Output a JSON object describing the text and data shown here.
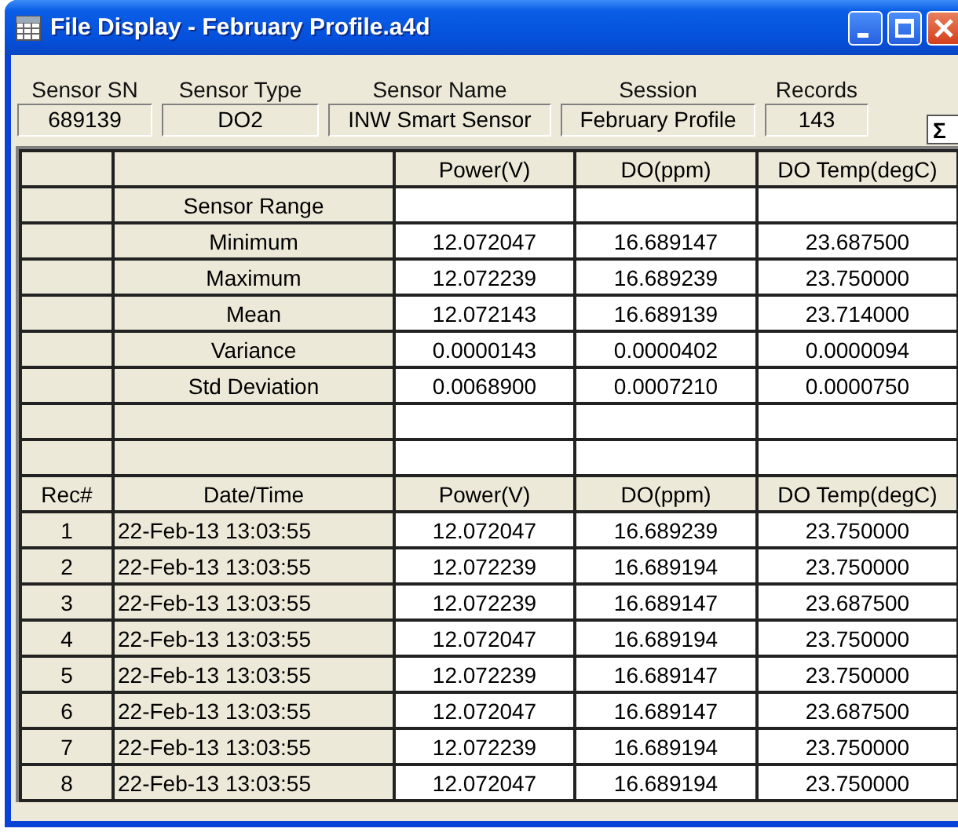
{
  "window": {
    "title": "File Display - February Profile.a4d"
  },
  "header_fields": [
    {
      "label": "Sensor SN",
      "value": "689139"
    },
    {
      "label": "Sensor Type",
      "value": "DO2"
    },
    {
      "label": "Sensor Name",
      "value": "INW Smart Sensor"
    },
    {
      "label": "Session",
      "value": "February Profile"
    },
    {
      "label": "Records",
      "value": "143"
    }
  ],
  "sum_button": "Σ",
  "stats_table": {
    "columns": [
      "Power(V)",
      "DO(ppm)",
      "DO Temp(degC)"
    ],
    "rows": [
      {
        "kind": "stat",
        "label": "Sensor Range"
      },
      {
        "kind": "stat",
        "label": "Minimum",
        "values": [
          "12.072047",
          "16.689147",
          "23.687500"
        ]
      },
      {
        "kind": "stat",
        "label": "Maximum",
        "values": [
          "12.072239",
          "16.689239",
          "23.750000"
        ]
      },
      {
        "kind": "stat",
        "label": "Mean",
        "values": [
          "12.072143",
          "16.689139",
          "23.714000"
        ]
      },
      {
        "kind": "stat",
        "label": "Variance",
        "values": [
          "0.0000143",
          "0.0000402",
          "0.0000094"
        ]
      },
      {
        "kind": "stat",
        "label": "Std Deviation",
        "values": [
          "0.0068900",
          "0.0007210",
          "0.0000750"
        ]
      },
      {
        "kind": "blank"
      },
      {
        "kind": "blank"
      }
    ]
  },
  "records_table": {
    "columns": [
      "Rec#",
      "Date/Time",
      "Power(V)",
      "DO(ppm)",
      "DO Temp(degC)"
    ],
    "rows": [
      [
        "1",
        "22-Feb-13 13:03:55",
        "12.072047",
        "16.689239",
        "23.750000"
      ],
      [
        "2",
        "22-Feb-13 13:03:55",
        "12.072239",
        "16.689194",
        "23.750000"
      ],
      [
        "3",
        "22-Feb-13 13:03:55",
        "12.072239",
        "16.689147",
        "23.687500"
      ],
      [
        "4",
        "22-Feb-13 13:03:55",
        "12.072047",
        "16.689194",
        "23.750000"
      ],
      [
        "5",
        "22-Feb-13 13:03:55",
        "12.072239",
        "16.689147",
        "23.750000"
      ],
      [
        "6",
        "22-Feb-13 13:03:55",
        "12.072047",
        "16.689147",
        "23.687500"
      ],
      [
        "7",
        "22-Feb-13 13:03:55",
        "12.072239",
        "16.689194",
        "23.750000"
      ],
      [
        "8",
        "22-Feb-13 13:03:55",
        "12.072047",
        "16.689194",
        "23.750000"
      ]
    ]
  }
}
